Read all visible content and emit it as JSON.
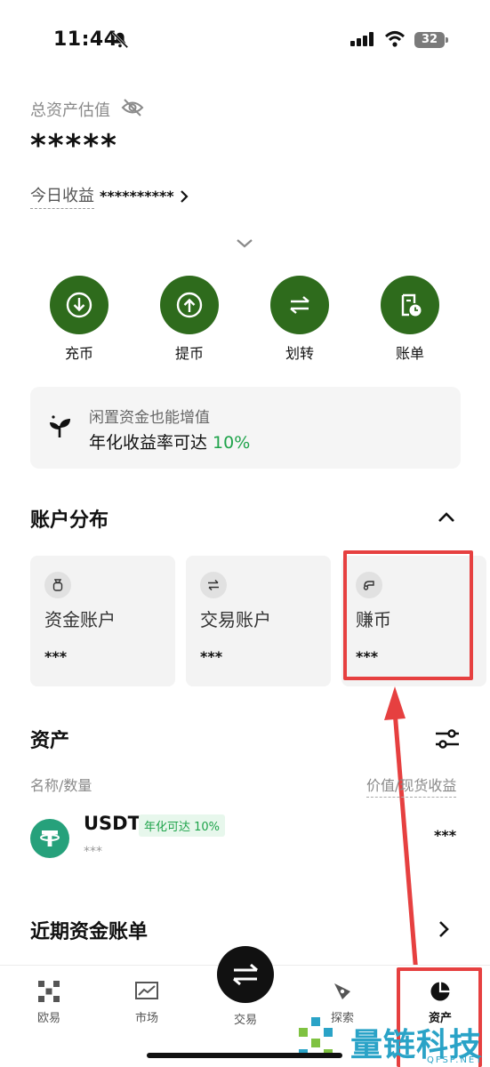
{
  "status_bar": {
    "time": "11:44",
    "battery": "32"
  },
  "header": {
    "total_label": "总资产估值",
    "total_value": "*****",
    "today_label": "今日收益",
    "today_value": "**********"
  },
  "actions": [
    {
      "label": "充币",
      "icon": "deposit-icon"
    },
    {
      "label": "提币",
      "icon": "withdraw-icon"
    },
    {
      "label": "划转",
      "icon": "transfer-icon"
    },
    {
      "label": "账单",
      "icon": "bill-icon"
    }
  ],
  "promo": {
    "line1": "闲置资金也能增值",
    "line2_prefix": "年化收益率可达 ",
    "rate": "10%"
  },
  "accounts_section": {
    "title": "账户分布",
    "cards": [
      {
        "name": "资金账户",
        "value": "***",
        "icon": "money-bag-icon"
      },
      {
        "name": "交易账户",
        "value": "***",
        "icon": "swap-icon"
      },
      {
        "name": "赚币",
        "value": "***",
        "icon": "earn-icon"
      }
    ]
  },
  "assets_section": {
    "title": "资产",
    "col_left": "名称/数量",
    "col_right": "价值/现货收益",
    "rows": [
      {
        "name": "USDT",
        "badge": "年化可达 10%",
        "sub": "***",
        "value": "***"
      }
    ]
  },
  "recent_bills": {
    "title": "近期资金账单"
  },
  "bottom_nav": {
    "items": [
      {
        "label": "欧易",
        "icon": "okx-logo-icon"
      },
      {
        "label": "市场",
        "icon": "market-chart-icon"
      },
      {
        "label": "交易",
        "icon": "trade-swap-icon"
      },
      {
        "label": "探索",
        "icon": "compass-icon"
      },
      {
        "label": "资产",
        "icon": "pie-chart-icon"
      }
    ]
  },
  "watermark": {
    "text": "量链科技",
    "sub": "QFSP.NET"
  },
  "colors": {
    "accent_green": "#2e6b1c",
    "rate_green": "#1ea34a",
    "highlight_red": "#e64040",
    "usdt": "#26a17b"
  }
}
